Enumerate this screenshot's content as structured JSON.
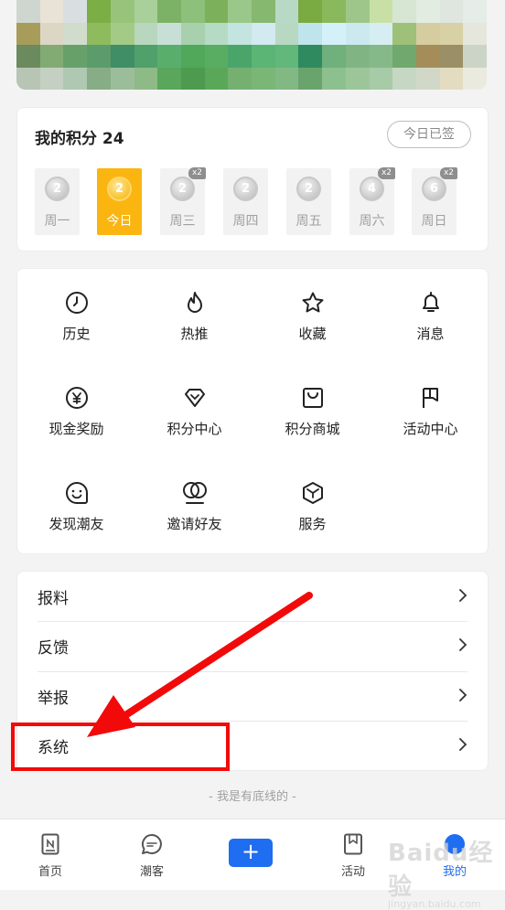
{
  "points": {
    "title": "我的积分 24",
    "signed_label": "今日已签",
    "days": [
      {
        "label": "周一",
        "coin": "2",
        "badge": ""
      },
      {
        "label": "今日",
        "coin": "2",
        "badge": "",
        "today": true
      },
      {
        "label": "周三",
        "coin": "2",
        "badge": "x2"
      },
      {
        "label": "周四",
        "coin": "2",
        "badge": ""
      },
      {
        "label": "周五",
        "coin": "2",
        "badge": ""
      },
      {
        "label": "周六",
        "coin": "4",
        "badge": "x2"
      },
      {
        "label": "周日",
        "coin": "6",
        "badge": "x2"
      }
    ]
  },
  "grid": {
    "items": [
      {
        "label": "历史",
        "icon": "clock-icon"
      },
      {
        "label": "热推",
        "icon": "flame-icon"
      },
      {
        "label": "收藏",
        "icon": "star-icon"
      },
      {
        "label": "消息",
        "icon": "bell-icon"
      },
      {
        "label": "现金奖励",
        "icon": "yuan-icon"
      },
      {
        "label": "积分中心",
        "icon": "diamond-icon"
      },
      {
        "label": "积分商城",
        "icon": "shopping-bag-icon"
      },
      {
        "label": "活动中心",
        "icon": "flag-icon"
      },
      {
        "label": "发现潮友",
        "icon": "smile-icon"
      },
      {
        "label": "邀请好友",
        "icon": "friends-icon"
      },
      {
        "label": "服务",
        "icon": "box-icon"
      }
    ]
  },
  "list": {
    "items": [
      {
        "label": "报料"
      },
      {
        "label": "反馈"
      },
      {
        "label": "举报"
      },
      {
        "label": "系统"
      }
    ]
  },
  "footer_note": "- 我是有底线的 -",
  "nav": {
    "items": [
      {
        "label": "首页",
        "icon": "home-doc-icon"
      },
      {
        "label": "潮客",
        "icon": "chat-icon"
      },
      {
        "label": "+",
        "icon": "plus-icon"
      },
      {
        "label": "活动",
        "icon": "bookmark-doc-icon"
      },
      {
        "label": "我的",
        "icon": "profile-icon",
        "active": true
      }
    ]
  },
  "watermark": {
    "text": "Baidu经验",
    "sub": "jingyan.baidu.com"
  },
  "colors": {
    "accent": "#1f6df0",
    "today": "#fbb511",
    "annotation": "#f20a0a"
  }
}
